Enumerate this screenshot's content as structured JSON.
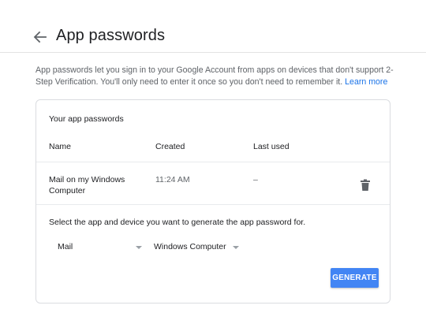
{
  "header": {
    "title": "App passwords"
  },
  "intro": {
    "text": "App passwords let you sign in to your Google Account from apps on devices that don't support 2-Step Verification. You'll only need to enter it once so you don't need to remember it.",
    "link": "Learn more"
  },
  "card": {
    "title": "Your app passwords",
    "columns": {
      "name": "Name",
      "created": "Created",
      "last_used": "Last used"
    },
    "rows": [
      {
        "name": "Mail on my Windows Computer",
        "created": "11:24 AM",
        "last_used": "–"
      }
    ],
    "prompt": "Select the app and device you want to generate the app password for.",
    "app_select": {
      "value": "Mail"
    },
    "device_select": {
      "value": "Windows Computer"
    },
    "generate_label": "GENERATE"
  },
  "colors": {
    "accent": "#4285f4",
    "link": "#1a73e8"
  }
}
